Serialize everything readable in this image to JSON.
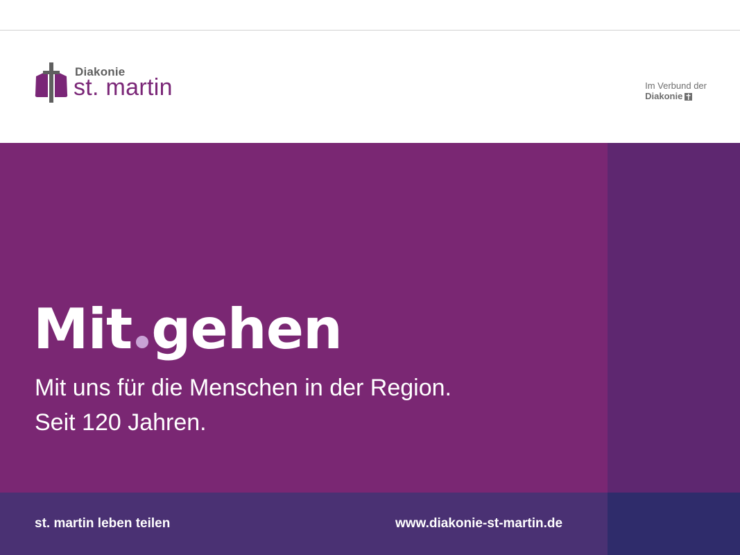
{
  "header": {
    "logo": {
      "small_text": "Diakonie",
      "big_text": "st. martin",
      "icon": "cross-logo-icon"
    },
    "partner": {
      "line1": "Im Verbund der",
      "line2": "Diakonie",
      "icon": "diakonie-mark-icon"
    }
  },
  "hero": {
    "headline_part1": "Mit",
    "headline_part2": "gehen",
    "subline1": "Mit uns für die Menschen in der Region.",
    "subline2": "Seit 120 Jahren."
  },
  "footer": {
    "slogan": "st. martin leben teilen",
    "url": "www.diakonie-st-martin.de"
  },
  "colors": {
    "brand_purple": "#7a2773",
    "side_purple": "#5e2770",
    "footer_purple": "#4a3173",
    "footer_side": "#2f2c6b",
    "dot_lilac": "#c9a3d6",
    "logo_text": "#7a2677",
    "gray_text": "#6e6e6e"
  }
}
